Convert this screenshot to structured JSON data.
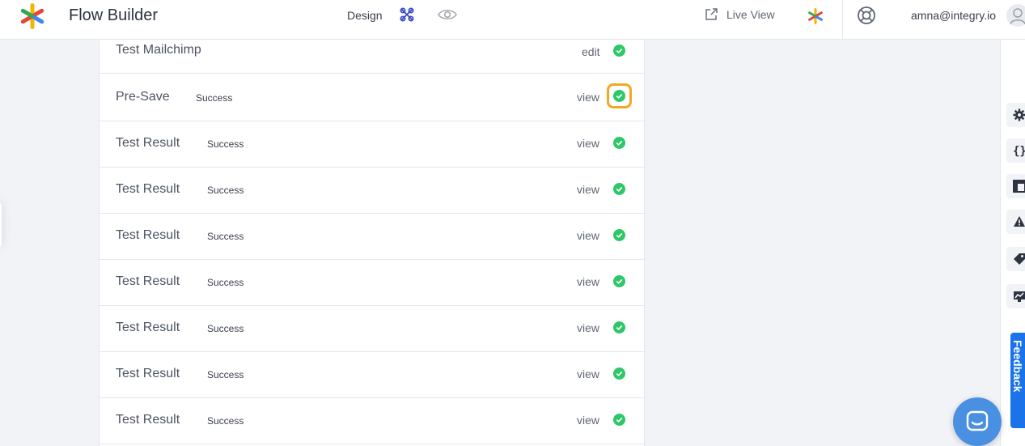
{
  "header": {
    "app_title": "Flow Builder",
    "design_label": "Design",
    "live_view_label": "Live View",
    "user_email": "amna@integry.io"
  },
  "steps": [
    {
      "title": "Test Mailchimp",
      "status": "",
      "action": "edit"
    },
    {
      "title": "Pre-Save",
      "status": "Success",
      "action": "view",
      "highlighted": true
    },
    {
      "title": "Test Result",
      "status": "Success",
      "action": "view"
    },
    {
      "title": "Test Result",
      "status": "Success",
      "action": "view"
    },
    {
      "title": "Test Result",
      "status": "Success",
      "action": "view"
    },
    {
      "title": "Test Result",
      "status": "Success",
      "action": "view"
    },
    {
      "title": "Test Result",
      "status": "Success",
      "action": "view"
    },
    {
      "title": "Test Result",
      "status": "Success",
      "action": "view"
    },
    {
      "title": "Test Result",
      "status": "Success",
      "action": "view"
    }
  ],
  "sidebar": {
    "tools": [
      "gear-icon",
      "braces-icon",
      "layout-icon",
      "warning-icon",
      "tag-icon",
      "chart-icon"
    ],
    "feedback_label": "Feedback"
  },
  "colors": {
    "success": "#2fc76a",
    "highlight": "#f5a623",
    "feedback": "#1a73e8",
    "chat": "#4a90e2"
  }
}
